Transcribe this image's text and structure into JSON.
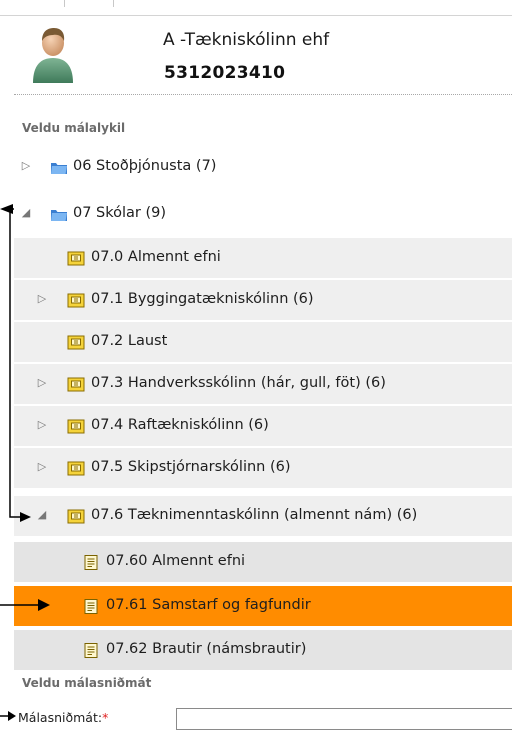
{
  "profile": {
    "company": "A -Tækniskólinn ehf",
    "reg_no": "5312023410",
    "avatar_icon": "user-avatar-icon"
  },
  "case_key_section": {
    "label": "Veldu málalykil"
  },
  "tree": {
    "items": [
      {
        "label": "06 Stoðþjónusta (7)",
        "state": "collapsed",
        "icon": "folder-icon"
      },
      {
        "label": "07 Skólar (9)",
        "state": "expanded",
        "icon": "folder-icon"
      },
      {
        "label": "07.0 Almennt efni",
        "state": "leaf",
        "icon": "box-folder-icon"
      },
      {
        "label": "07.1 Byggingatækniskólinn (6)",
        "state": "collapsed",
        "icon": "box-folder-icon"
      },
      {
        "label": "07.2 Laust",
        "state": "leaf",
        "icon": "box-folder-icon"
      },
      {
        "label": "07.3 Handverksskólinn (hár, gull, föt) (6)",
        "state": "collapsed",
        "icon": "box-folder-icon"
      },
      {
        "label": "07.4 Raftækniskólinn (6)",
        "state": "collapsed",
        "icon": "box-folder-icon"
      },
      {
        "label": "07.5 Skipstjórnarskólinn (6)",
        "state": "collapsed",
        "icon": "box-folder-icon"
      },
      {
        "label": "07.6 Tæknimenntaskólinn (almennt nám) (6)",
        "state": "expanded",
        "icon": "box-folder-icon"
      },
      {
        "label": "07.60 Almennt efni",
        "state": "leaf",
        "icon": "document-icon"
      },
      {
        "label": "07.61 Samstarf og fagfundir",
        "state": "selected",
        "icon": "document-icon"
      },
      {
        "label": "07.62 Brautir (námsbrautir)",
        "state": "leaf",
        "icon": "document-icon"
      }
    ]
  },
  "template_section": {
    "label": "Veldu málasniðmát"
  },
  "template_field": {
    "label": "Málasniðmát:",
    "required_mark": "*",
    "value": ""
  },
  "colors": {
    "selected": "#ff8c00",
    "required": "#e02020"
  }
}
